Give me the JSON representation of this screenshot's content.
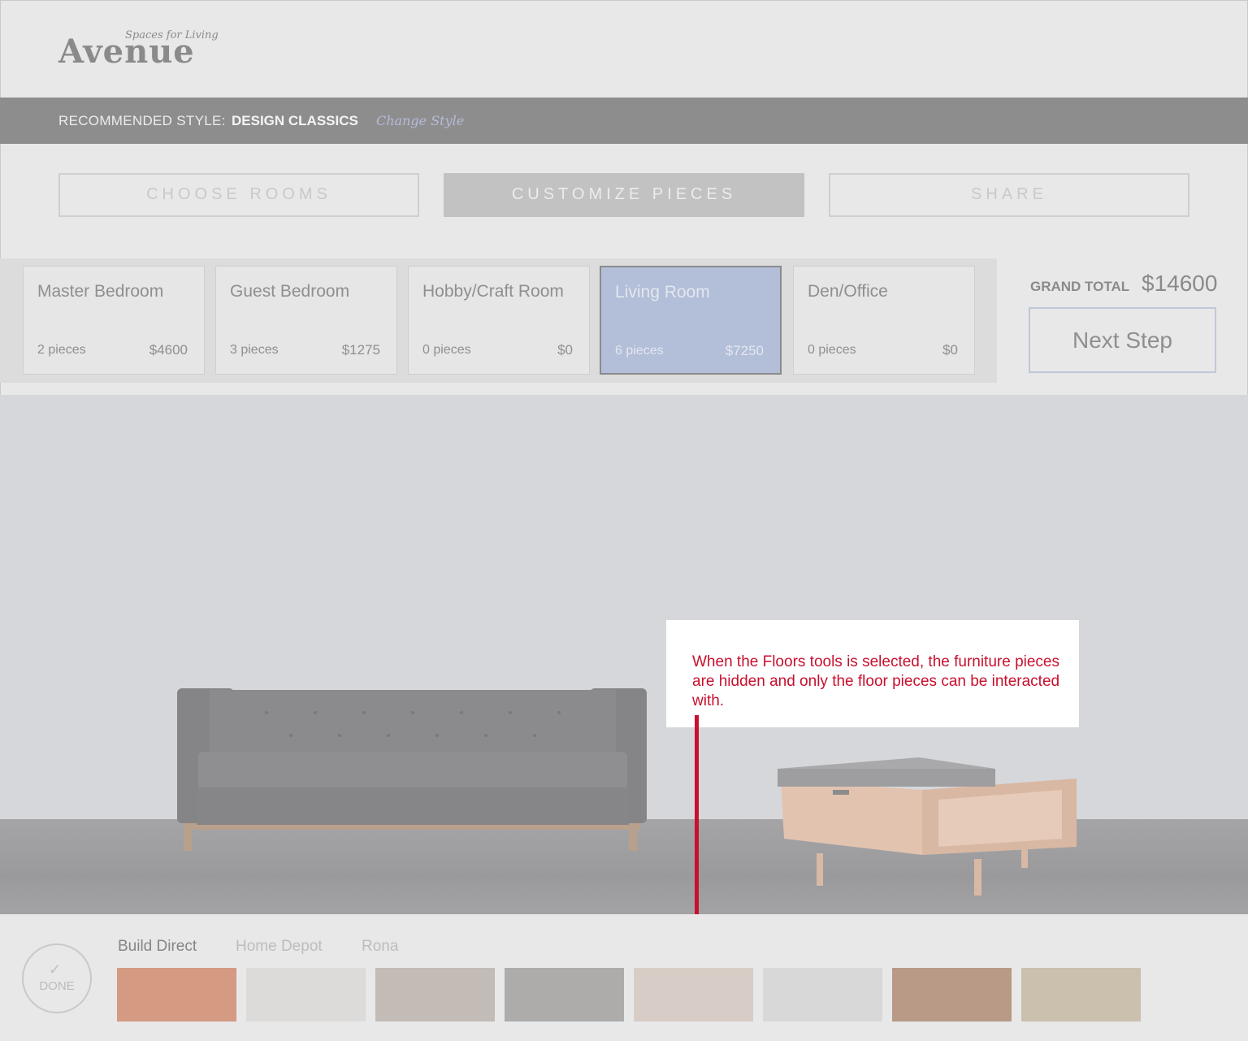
{
  "logo": {
    "tagline": "Spaces for Living",
    "name": "Avenue"
  },
  "style_bar": {
    "label": "RECOMMENDED STYLE:",
    "value": "DESIGN CLASSICS",
    "change_link": "Change Style"
  },
  "steps": [
    {
      "label": "CHOOSE ROOMS",
      "active": false
    },
    {
      "label": "CUSTOMIZE PIECES",
      "active": true
    },
    {
      "label": "SHARE",
      "active": false
    }
  ],
  "rooms": [
    {
      "name": "Master Bedroom",
      "pieces": "2 pieces",
      "price": "$4600",
      "active": false
    },
    {
      "name": "Guest Bedroom",
      "pieces": "3 pieces",
      "price": "$1275",
      "active": false
    },
    {
      "name": "Hobby/Craft Room",
      "pieces": "0 pieces",
      "price": "$0",
      "active": false
    },
    {
      "name": "Living Room",
      "pieces": "6 pieces",
      "price": "$7250",
      "active": true
    },
    {
      "name": "Den/Office",
      "pieces": "0 pieces",
      "price": "$0",
      "active": false
    }
  ],
  "summary": {
    "grand_total_label": "GRAND TOTAL",
    "grand_total_value": "$14600",
    "next_button": "Next Step"
  },
  "callout": {
    "text": "When the Floors tools is selected, the furniture pieces are hidden and only the floor pieces can be interacted with."
  },
  "floor_tools": {
    "done_label": "DONE",
    "vendors": [
      {
        "name": "Build Direct",
        "active": true
      },
      {
        "name": "Home Depot",
        "active": false
      },
      {
        "name": "Rona",
        "active": false
      }
    ],
    "swatches": [
      {
        "name": "warm-oak",
        "color": "#d49a82"
      },
      {
        "name": "pale-white",
        "color": "#dcdbda"
      },
      {
        "name": "grey-plank",
        "color": "#c3bbb5"
      },
      {
        "name": "dark-grey",
        "color": "#aeabab"
      },
      {
        "name": "beige-stone",
        "color": "#d8ccc6"
      },
      {
        "name": "light-grey",
        "color": "#d9d8d8"
      },
      {
        "name": "honey-wood",
        "color": "#b89a86"
      },
      {
        "name": "distressed-pine",
        "color": "#cbbfae"
      }
    ]
  },
  "colors": {
    "accent_blue": "#b3bed8",
    "annotation_red": "#c8102e",
    "band_grey": "#8e8d8e"
  }
}
